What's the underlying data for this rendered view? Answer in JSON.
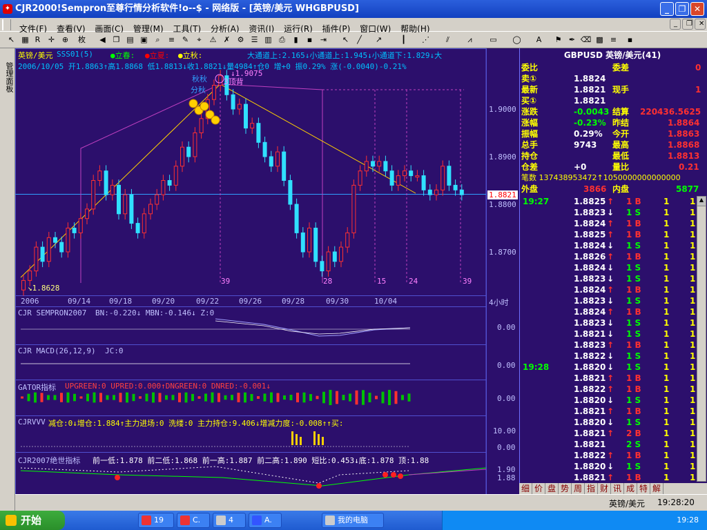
{
  "window": {
    "title": "CJR2000!Sempron至尊行情分析软件!o--$ - 网络版 - [英镑/美元 WHGBPUSD]"
  },
  "menu": [
    "文件(F)",
    "查看(V)",
    "画面(C)",
    "管理(M)",
    "工具(T)",
    "分析(A)",
    "资讯(I)",
    "运行(R)",
    "插件(P)",
    "窗口(W)",
    "帮助(H)"
  ],
  "sidebar": {
    "label": "管理面板"
  },
  "chart": {
    "symbol": "英镑/美元",
    "indicator": "SSS01(5)",
    "solar_terms": [
      "立春:",
      "立夏:",
      "立秋:"
    ],
    "channel": "大通道上:2.165↓小通道上:1.945↓小通道下:1.829↓大",
    "info_line": "2006/10/05 开1.8863↑高1.8868 低1.8813↓收1.8821↓量4984↑仓0 增+0 振0.29% 涨(-0.0040)-0.21%",
    "annotations": {
      "high": "1.9075",
      "low": "1.8628",
      "top_label": "3顶背",
      "autumn": "秋秋",
      "divide": "分秋"
    },
    "y_ticks": [
      "1.9000",
      "1.8900",
      "1.8821",
      "1.8800",
      "1.8700"
    ],
    "x_ticks": [
      "2006",
      "09/14",
      "09/18",
      "09/20",
      "09/22",
      "09/26",
      "09/28",
      "09/30",
      "10/04"
    ],
    "period": "4小时",
    "cycle_labels": [
      "39",
      "28",
      "15",
      "24",
      "39"
    ],
    "panels": [
      {
        "title": "CJR SEMPRON2007",
        "params": "BN:-0.220↓ MBN:-0.146↓ Z:0",
        "value": "0.00"
      },
      {
        "title": "CJR MACD(26,12,9)",
        "params": "JC:0",
        "value": "0.00"
      },
      {
        "title": "GATOR指标",
        "params": "UPGREEN:0 UPRED:0.000↑DNGREEN:0 DNRED:-0.001↓",
        "value": "0.00"
      },
      {
        "title": "CJRVVV",
        "params": "减仓:0↓增仓:1.884↑主力进场:0 洗缕:0 主力持仓:9.406↓增减力度:-0.008↑↑买:",
        "value": "10.00",
        "value2": "0.00"
      },
      {
        "title": "CJR2007绝世指标",
        "params": "前一低:1.878 前二低:1.868 前一高:1.887 前二高:1.890 短比:0.453↓底:1.878 顶:1.88",
        "value": "1.90",
        "value2": "1.88"
      }
    ]
  },
  "quote": {
    "header": "GBPUSD 英镑/美元(41)",
    "rows": [
      {
        "l1": "委比",
        "v1": "",
        "l2": "委差",
        "v2": "0"
      },
      {
        "l1": "卖①",
        "v1": "1.8824",
        "l2": "",
        "v2": ""
      },
      {
        "l1": "最新",
        "v1": "1.8821",
        "l2": "现手",
        "v2": "1"
      },
      {
        "l1": "买①",
        "v1": "1.8821",
        "l2": "",
        "v2": ""
      },
      {
        "l1": "涨跌",
        "v1": "-0.0043",
        "l2": "结算",
        "v2": "220436.5625"
      },
      {
        "l1": "涨幅",
        "v1": "-0.23%",
        "l2": "昨结",
        "v2": "1.8864"
      },
      {
        "l1": "振幅",
        "v1": "0.29%",
        "l2": "今开",
        "v2": "1.8863"
      },
      {
        "l1": "总手",
        "v1": "9743",
        "l2": "最高",
        "v2": "1.8868"
      },
      {
        "l1": "持仓",
        "v1": "",
        "l2": "最低",
        "v2": "1.8813"
      },
      {
        "l1": "仓差",
        "v1": "+0",
        "l2": "量比",
        "v2": "0.21"
      }
    ],
    "bishu": "笔数 137438953472↑1050000000000000",
    "waipan_label": "外盘",
    "waipan": "3866",
    "neipan_label": "内盘",
    "neipan": "5877",
    "ticks1_time": "19:27",
    "ticks1": [
      [
        "1.8825",
        "↑",
        "1 B",
        "1",
        "1"
      ],
      [
        "1.8823",
        "↓",
        "1 S",
        "1",
        "1"
      ],
      [
        "1.8824",
        "↑",
        "1 B",
        "1",
        "1"
      ],
      [
        "1.8825",
        "↑",
        "1 B",
        "1",
        "1"
      ],
      [
        "1.8824",
        "↓",
        "1 S",
        "1",
        "1"
      ],
      [
        "1.8826",
        "↑",
        "1 B",
        "1",
        "1"
      ],
      [
        "1.8824",
        "↓",
        "1 S",
        "1",
        "1"
      ],
      [
        "1.8823",
        "↓",
        "1 S",
        "1",
        "1"
      ],
      [
        "1.8824",
        "↑",
        "1 B",
        "1",
        "1"
      ],
      [
        "1.8823",
        "↓",
        "1 S",
        "1",
        "1"
      ],
      [
        "1.8824",
        "↑",
        "1 B",
        "1",
        "1"
      ],
      [
        "1.8823",
        "↓",
        "1 S",
        "1",
        "1"
      ],
      [
        "1.8821",
        "↓",
        "1 S",
        "1",
        "1"
      ],
      [
        "1.8823",
        "↑",
        "1 B",
        "1",
        "1"
      ],
      [
        "1.8822",
        "↓",
        "1 S",
        "1",
        "1"
      ]
    ],
    "ticks2_time": "19:28",
    "ticks2": [
      [
        "1.8820",
        "↓",
        "1 S",
        "1",
        "1"
      ],
      [
        "1.8821",
        "↑",
        "1 B",
        "1",
        "1"
      ],
      [
        "1.8822",
        "↑",
        "1 B",
        "1",
        "1"
      ],
      [
        "1.8820",
        "↓",
        "1 S",
        "1",
        "1"
      ],
      [
        "1.8821",
        "↑",
        "1 B",
        "1",
        "1"
      ],
      [
        "1.8820",
        "↓",
        "1 S",
        "1",
        "1"
      ],
      [
        "1.8821",
        "↑",
        "2 B",
        "1",
        "1"
      ],
      [
        "1.8821",
        "",
        "2 S",
        "1",
        "1"
      ],
      [
        "1.8822",
        "↑",
        "1 B",
        "1",
        "1"
      ],
      [
        "1.8820",
        "↓",
        "1 S",
        "1",
        "1"
      ],
      [
        "1.8821",
        "↑",
        "1 B",
        "1",
        "1"
      ]
    ],
    "tabs": [
      "细",
      "价",
      "盘",
      "势",
      "周",
      "指",
      "财",
      "讯",
      "成",
      "特",
      "解"
    ]
  },
  "status": {
    "symbol": "英镑/美元",
    "time": "19:28:20"
  },
  "taskbar": {
    "start": "开始",
    "buttons": [
      "19",
      "C.",
      "4",
      "A.",
      "我的电脑"
    ],
    "clock": "19:28"
  },
  "colors": {
    "bg": "#2c0f6c",
    "up": "#ff3030",
    "down": "#30e0ff",
    "label": "#ffff00",
    "grid": "#5050d0"
  }
}
